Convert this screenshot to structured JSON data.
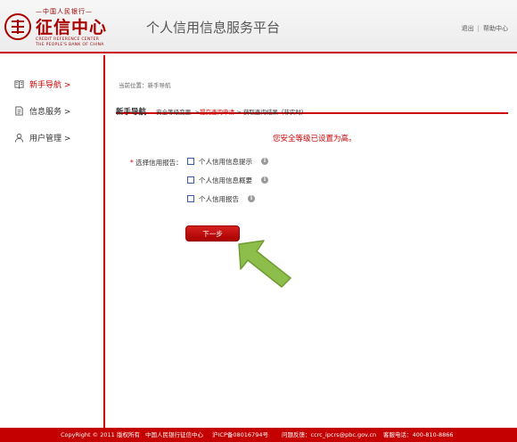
{
  "header": {
    "logo_top": "—中国人民银行—",
    "logo_main": "征信中心",
    "logo_sub1": "CREDIT REFERENCE CENTER",
    "logo_sub2": "THE PEOPLE'S BANK OF CHINA",
    "platform_title": "个人信用信息服务平台",
    "links": {
      "logout": "退出",
      "separator": "|",
      "help": "帮助中心"
    }
  },
  "sidebar": {
    "items": [
      {
        "label": "新手导航 >",
        "icon": "book-icon",
        "active": true
      },
      {
        "label": "信息服务 >",
        "icon": "document-icon",
        "active": false
      },
      {
        "label": "用户管理 >",
        "icon": "user-icon",
        "active": false
      }
    ]
  },
  "main": {
    "breadcrumb": "当前位置：新手导航",
    "guide_title": "新手导航",
    "guide_steps": {
      "step1": "安全等级变更 ->",
      "step2": "提交查询申请",
      "step3": "-> 获取查询结果（非实时）"
    },
    "security_message": "您安全等级已设置为高。",
    "select_label_required": "*",
    "select_label": "选择信用报告：",
    "options": [
      {
        "label": "个人信用信息提示",
        "checked": false
      },
      {
        "label": "个人信用信息概要",
        "checked": false
      },
      {
        "label": "个人信用报告",
        "checked": false
      }
    ],
    "info_glyph": "i",
    "next_button": "下一步"
  },
  "footer": {
    "copyright": "CopyRight © 2011",
    "rights": "版权所有",
    "org": "中国人民银行征信中心",
    "icp": "沪ICP备08016794号",
    "feedback": "问题反馈：ccrc_ipcrs@pbc.gov.cn",
    "phone": "客服电话：400-810-8866"
  },
  "colors": {
    "accent": "#c00000",
    "arrow": "#8dbd4a"
  }
}
